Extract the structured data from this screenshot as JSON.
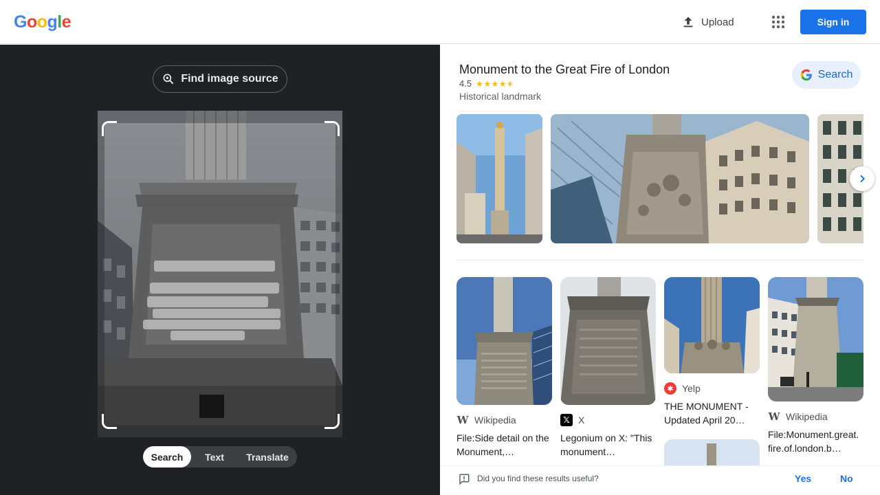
{
  "header": {
    "logo_letters": [
      "G",
      "o",
      "o",
      "g",
      "l",
      "e"
    ],
    "logo_colors": [
      "#4285f4",
      "#ea4335",
      "#fbbc05",
      "#4285f4",
      "#34a853",
      "#ea4335"
    ],
    "upload_label": "Upload",
    "apps_icon": "apps-grid-icon",
    "signin_label": "Sign in"
  },
  "lens": {
    "find_source_label": "Find image source",
    "modes": [
      "Search",
      "Text",
      "Translate"
    ],
    "active_mode": "Search"
  },
  "knowledge_panel": {
    "title": "Monument to the Great Fire of London",
    "rating": "4.5",
    "rating_value": 4.5,
    "type": "Historical landmark",
    "search_label": "Search"
  },
  "results": [
    {
      "source": "Wikipedia",
      "source_icon": "wikipedia-icon",
      "title": "File:Side detail on the Monument,…"
    },
    {
      "source": "X",
      "source_icon": "x-icon",
      "title": "Legonium on X: \"This monument…"
    },
    {
      "source": "Yelp",
      "source_icon": "yelp-icon",
      "title": "THE MONUMENT - Updated April 20…"
    },
    {
      "source": "Wikipedia",
      "source_icon": "wikipedia-icon",
      "title": "File:Monument.great.fire.of.london.b…"
    }
  ],
  "feedback": {
    "question": "Did you find these results useful?",
    "yes_label": "Yes",
    "no_label": "No"
  },
  "colors": {
    "accent": "#1a73e8",
    "dark_bg": "#202124",
    "star": "#fbbc04"
  }
}
